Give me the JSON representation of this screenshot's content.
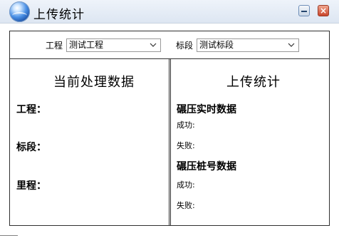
{
  "window": {
    "title": "上传统计",
    "close_glyph": "×"
  },
  "filter": {
    "project_label": "工程",
    "project_value": "测试工程",
    "section_label": "标段",
    "section_value": "测试标段"
  },
  "left_panel": {
    "heading": "当前处理数据",
    "project_field": "工程：",
    "section_field": "标段：",
    "mileage_field": "里程："
  },
  "right_panel": {
    "heading": "上传统计",
    "realtime_title": "碾压实时数据",
    "realtime_success": "成功:",
    "realtime_fail": "失败:",
    "pile_title": "碾压桩号数据",
    "pile_success": "成功:",
    "pile_fail": "失败:"
  },
  "colors": {
    "border": "#303030",
    "titlebar": "#dde6f2",
    "close": "#c9452b"
  }
}
